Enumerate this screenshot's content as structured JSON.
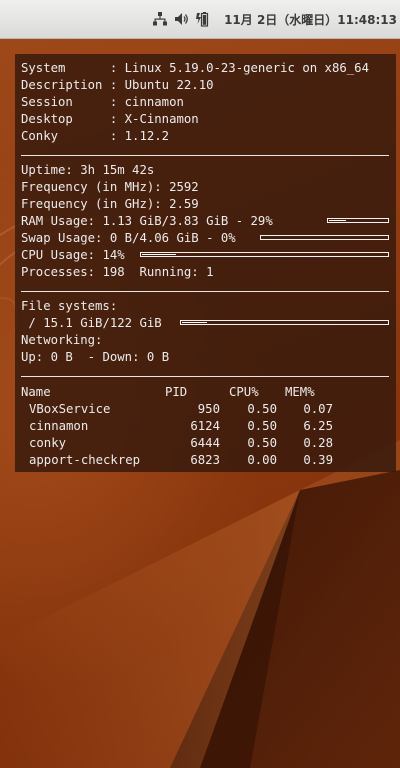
{
  "top_panel": {
    "icons": [
      "network-icon",
      "volume-icon",
      "battery-icon"
    ],
    "clock": "11月  2日（水曜日）11:48:13"
  },
  "conky": {
    "system_info": [
      {
        "label": "System     ",
        "value": "Linux 5.19.0-23-generic on x86_64"
      },
      {
        "label": "Description",
        "value": "Ubuntu 22.10"
      },
      {
        "label": "Session    ",
        "value": "cinnamon"
      },
      {
        "label": "Desktop    ",
        "value": "X-Cinnamon"
      },
      {
        "label": "Conky      ",
        "value": "1.12.2"
      }
    ],
    "uptime": {
      "label": "Uptime:",
      "value": "3h 15m 42s"
    },
    "freq_mhz": {
      "label": "Frequency (in MHz):",
      "value": "2592"
    },
    "freq_ghz": {
      "label": "Frequency (in GHz):",
      "value": "2.59"
    },
    "ram": {
      "label": "RAM Usage:",
      "value": "1.13 GiB/3.83 GiB - 29%",
      "percent": 29
    },
    "swap": {
      "label": "Swap Usage:",
      "value": "0 B/4.06 GiB - 0%",
      "percent": 0
    },
    "cpu": {
      "label": "CPU Usage:",
      "value": "14%",
      "percent": 14
    },
    "processes": {
      "label": "Processes:",
      "value": "198",
      "running_label": "Running:",
      "running_value": "1"
    },
    "filesystems": {
      "label": "File systems:",
      "mount": "/",
      "value": "15.1 GiB/122 GiB",
      "percent": 12
    },
    "networking": {
      "label": "Networking:",
      "up_label": "Up:",
      "up_value": "0 B",
      "down_label": "- Down:",
      "down_value": "0 B"
    },
    "process_table": {
      "headers": [
        "Name",
        "PID",
        "CPU%",
        "MEM%"
      ],
      "rows": [
        [
          "VBoxService",
          "950",
          "0.50",
          "0.07"
        ],
        [
          "cinnamon",
          "6124",
          "0.50",
          "6.25"
        ],
        [
          "conky",
          "6444",
          "0.50",
          "0.28"
        ],
        [
          "apport-checkrep",
          "6823",
          "0.00",
          "0.39"
        ]
      ]
    }
  }
}
